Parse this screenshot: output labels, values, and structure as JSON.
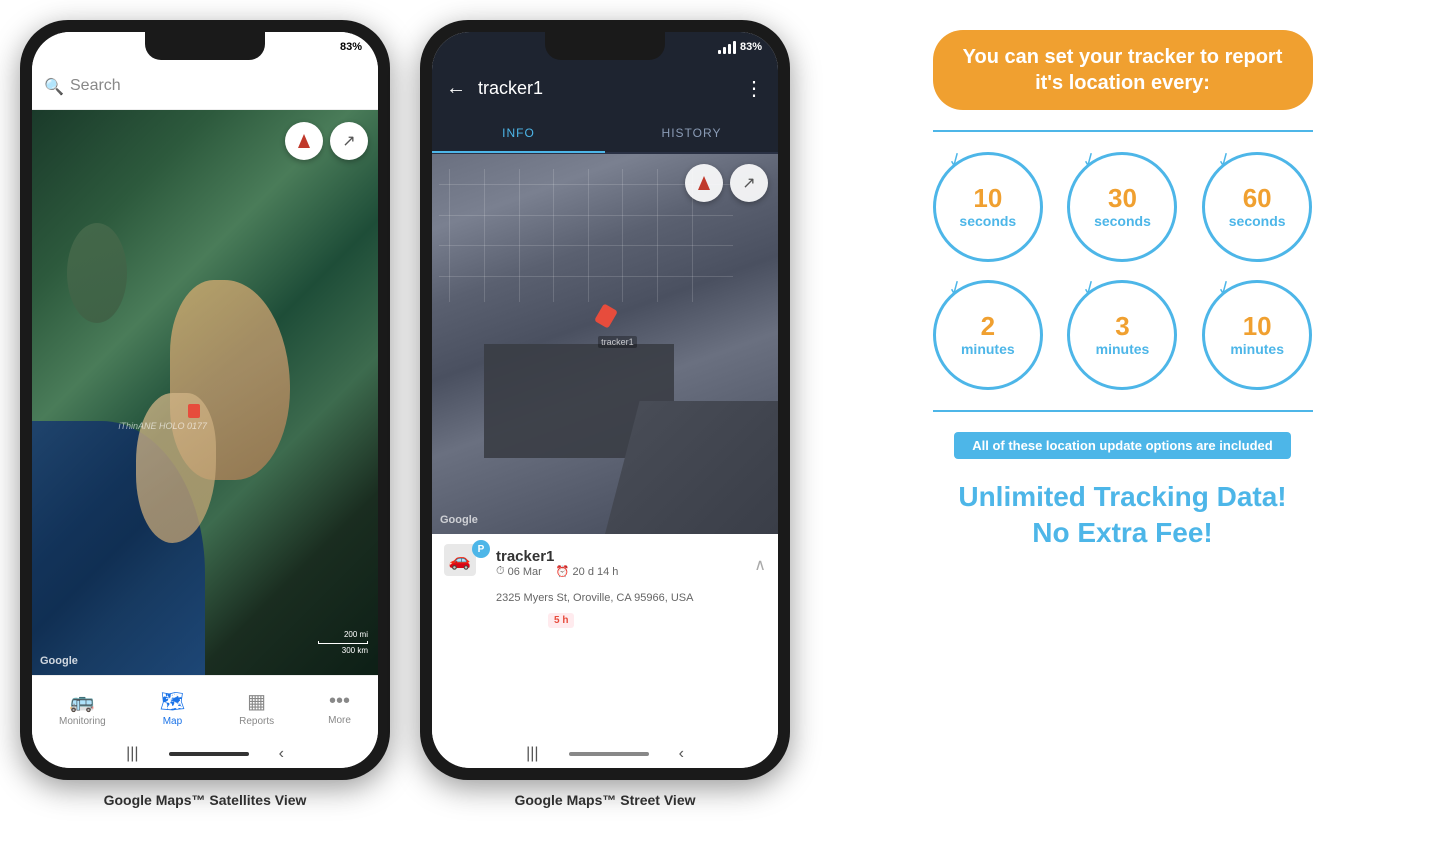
{
  "phones": {
    "phone1": {
      "status": {
        "time": "",
        "signal": "83%"
      },
      "search_placeholder": "Search",
      "map_label": "iThinANE HOLO 0177",
      "google_watermark": "Google",
      "scale_labels": [
        "200 mi",
        "300 km"
      ],
      "nav_items": [
        {
          "label": "Monitoring",
          "icon": "🚌",
          "active": false
        },
        {
          "label": "Map",
          "icon": "🗺",
          "active": true
        },
        {
          "label": "Reports",
          "icon": "▦",
          "active": false
        },
        {
          "label": "More",
          "icon": "•••",
          "active": false
        }
      ],
      "caption": "Google Maps™ Satellites View"
    },
    "phone2": {
      "status": {
        "time": "",
        "signal": "83%"
      },
      "header": {
        "back": "←",
        "title": "tracker1",
        "more": "⋮"
      },
      "tabs": [
        {
          "label": "INFO",
          "active": true
        },
        {
          "label": "HISTORY",
          "active": false
        }
      ],
      "google_watermark": "Google",
      "info_panel": {
        "tracker_name": "tracker1",
        "parking_label": "P",
        "date": "06 Mar",
        "duration": "20 d 14 h",
        "address": "2325 Myers St, Oroville, CA 95966, USA",
        "time_badge": "5 h"
      },
      "caption": "Google Maps™ Street View"
    }
  },
  "info_section": {
    "headline": "You can set your tracker\nto report it's location every:",
    "divider_color": "#4db6e8",
    "circles": [
      {
        "number": "10",
        "unit": "seconds"
      },
      {
        "number": "30",
        "unit": "seconds"
      },
      {
        "number": "60",
        "unit": "seconds"
      },
      {
        "number": "2",
        "unit": "minutes"
      },
      {
        "number": "3",
        "unit": "minutes"
      },
      {
        "number": "10",
        "unit": "minutes"
      }
    ],
    "included_label": "All of these location update options are included",
    "unlimited_line1": "Unlimited Tracking Data!",
    "unlimited_line2": "No Extra Fee!"
  }
}
